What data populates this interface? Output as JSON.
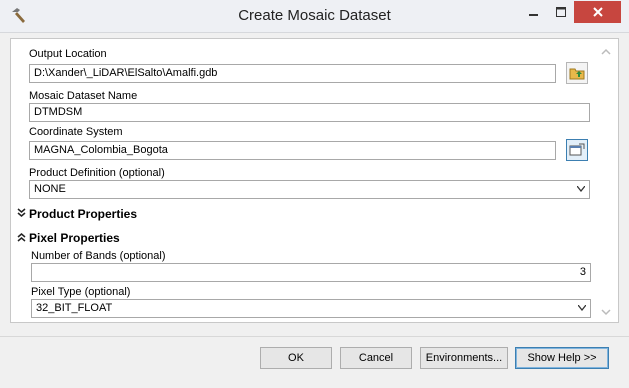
{
  "window": {
    "title": "Create Mosaic Dataset"
  },
  "form": {
    "output_location": {
      "label": "Output Location",
      "value": "D:\\Xander\\_LiDAR\\ElSalto\\Amalfi.gdb"
    },
    "dataset_name": {
      "label": "Mosaic Dataset Name",
      "value": "DTMDSM"
    },
    "coordinate_system": {
      "label": "Coordinate System",
      "value": "MAGNA_Colombia_Bogota"
    },
    "product_definition": {
      "label": "Product Definition (optional)",
      "value": "NONE"
    },
    "product_properties": {
      "label": "Product Properties",
      "state": "collapsed"
    },
    "pixel_properties": {
      "label": "Pixel Properties",
      "state": "expanded"
    },
    "number_of_bands": {
      "label": "Number of Bands (optional)",
      "value": "3"
    },
    "pixel_type": {
      "label": "Pixel Type (optional)",
      "value": "32_BIT_FLOAT"
    }
  },
  "buttons": {
    "ok": "OK",
    "cancel": "Cancel",
    "environments": "Environments...",
    "show_help": "Show Help >>"
  },
  "colors": {
    "close_button": "#c7463f",
    "focus_border": "#3c7fb1"
  }
}
